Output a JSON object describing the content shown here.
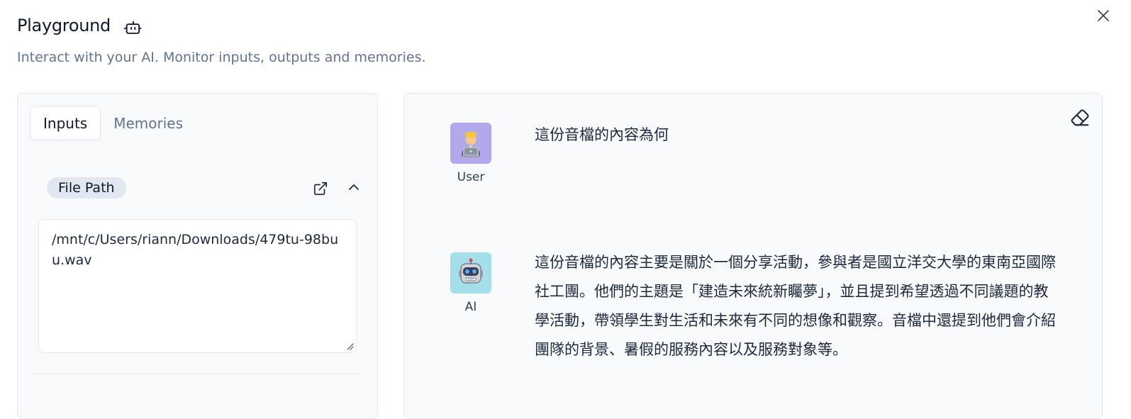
{
  "header": {
    "title": "Playground",
    "subtitle": "Interact with your AI. Monitor inputs, outputs and memories."
  },
  "icons": {
    "title_icon": "bot-icon",
    "close": "close-icon",
    "external": "external-link-icon",
    "collapse": "chevron-up-icon",
    "eraser": "eraser-icon"
  },
  "left_panel": {
    "tabs": [
      {
        "label": "Inputs",
        "active": true
      },
      {
        "label": "Memories",
        "active": false
      }
    ],
    "input": {
      "label": "File Path",
      "value": "/mnt/c/Users/riann/Downloads/479tu-98buu.wav"
    }
  },
  "chat": {
    "messages": [
      {
        "role": "User",
        "avatar": "👨‍💻",
        "avatar_color": "#b4a8ec",
        "text": "這份音檔的內容為何"
      },
      {
        "role": "AI",
        "avatar": "🤖",
        "avatar_color": "#a5e0ea",
        "text": "這份音檔的內容主要是關於一個分享活動，參與者是國立洋交大學的東南亞國際社工團。他們的主題是「建造未來統新矚夢」，並且提到希望透過不同議題的教學活動，帶領學生對生活和未來有不同的想像和觀察。音檔中還提到他們會介紹團隊的背景、暑假的服務內容以及服務對象等。"
      }
    ]
  },
  "colors": {
    "panel_bg": "#f8fafc",
    "border": "#e2e8f0",
    "muted_text": "#64748b",
    "primary_text": "#0f172a"
  }
}
